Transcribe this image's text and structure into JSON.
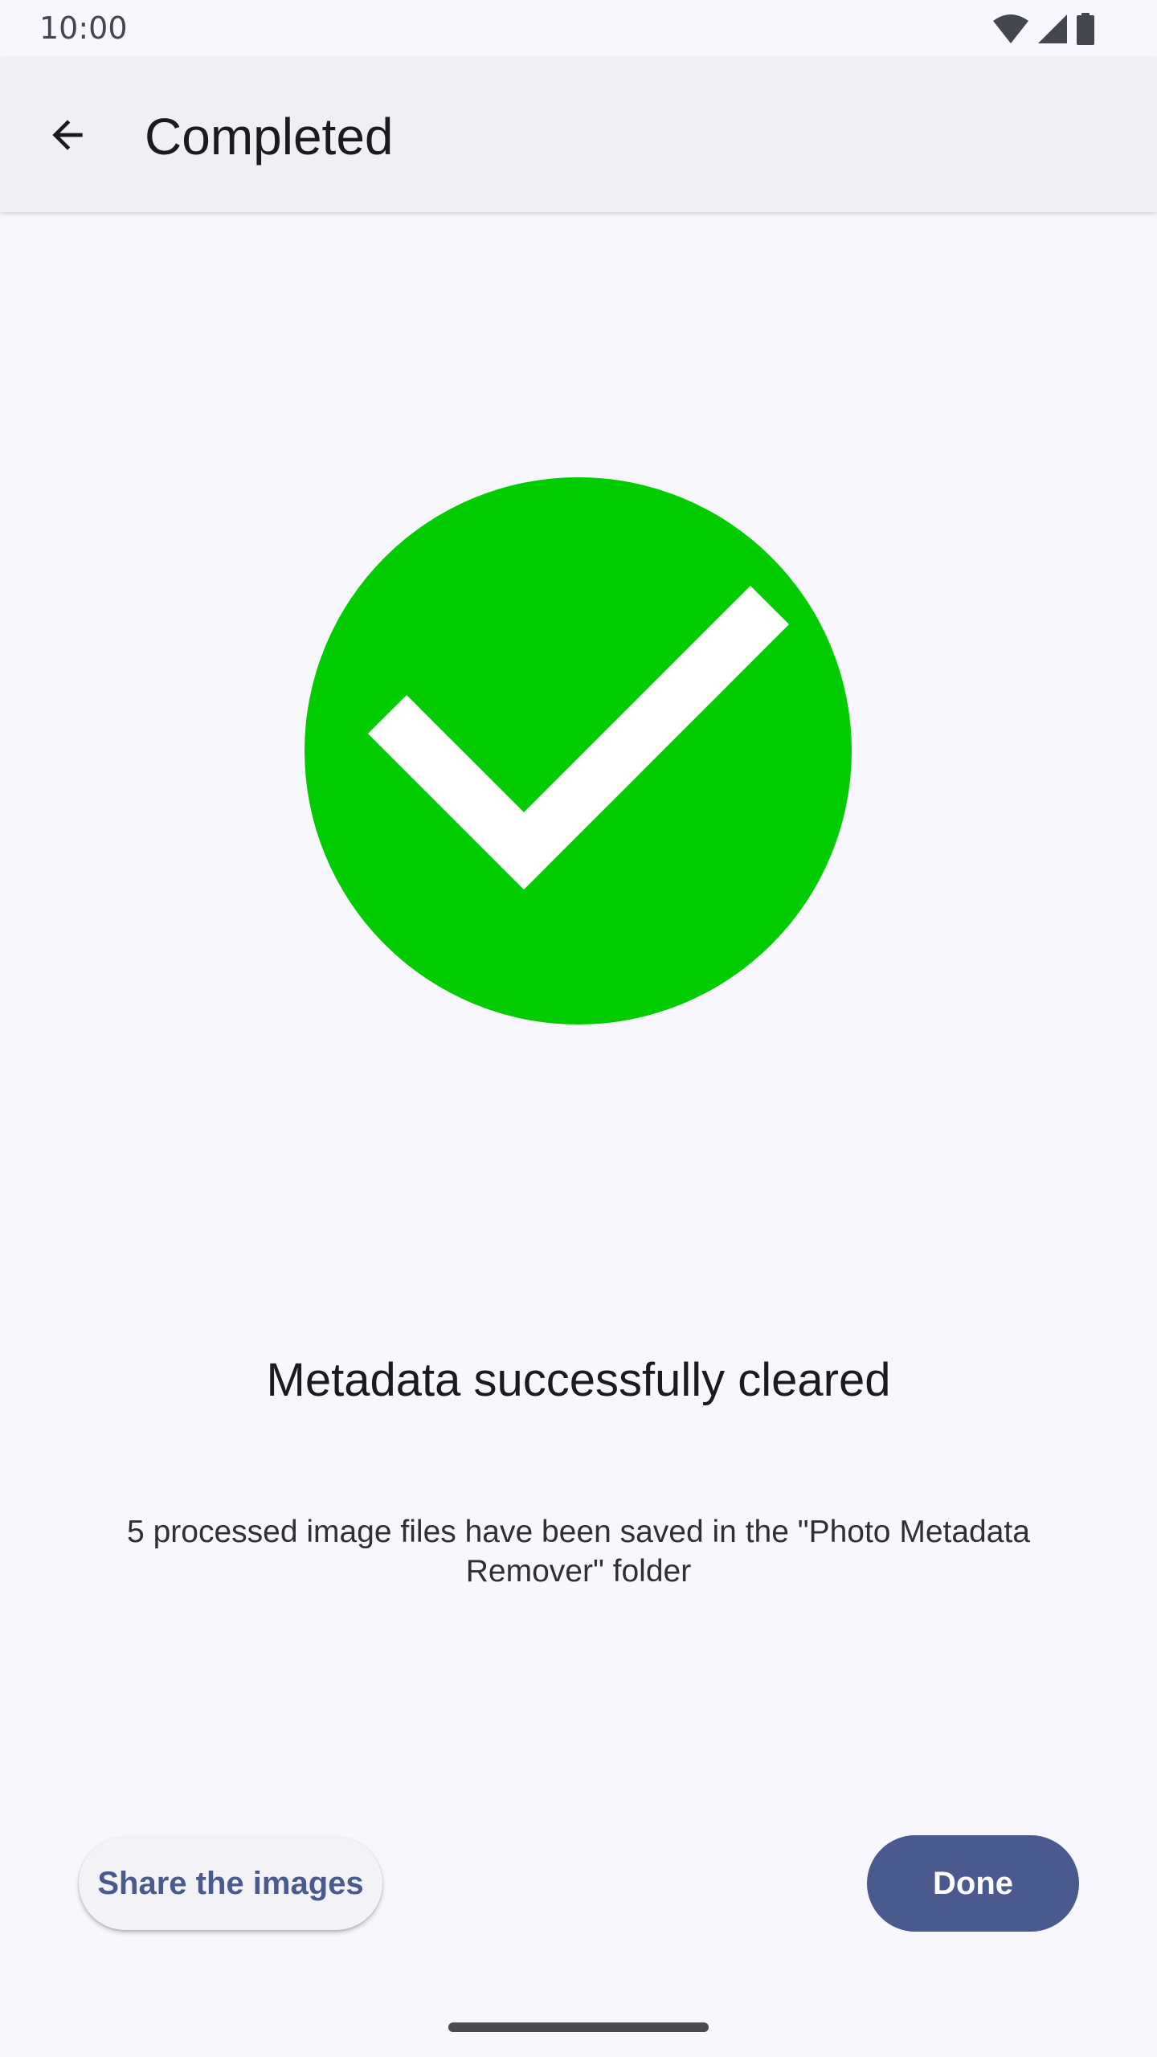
{
  "status_bar": {
    "time": "10:00",
    "icons": [
      "wifi-icon",
      "cell-signal-icon",
      "battery-icon"
    ]
  },
  "app_bar": {
    "title": "Completed",
    "back_icon": "arrow-back-icon"
  },
  "content": {
    "success_icon": "check-circle-icon",
    "success_color": "#00cc00",
    "headline": "Metadata successfully cleared",
    "description": "5 processed image files have been saved in the \"Photo Metadata Remover\" folder"
  },
  "actions": {
    "share_label": "Share the images",
    "done_label": "Done",
    "accent_color": "#4a5a8f"
  }
}
